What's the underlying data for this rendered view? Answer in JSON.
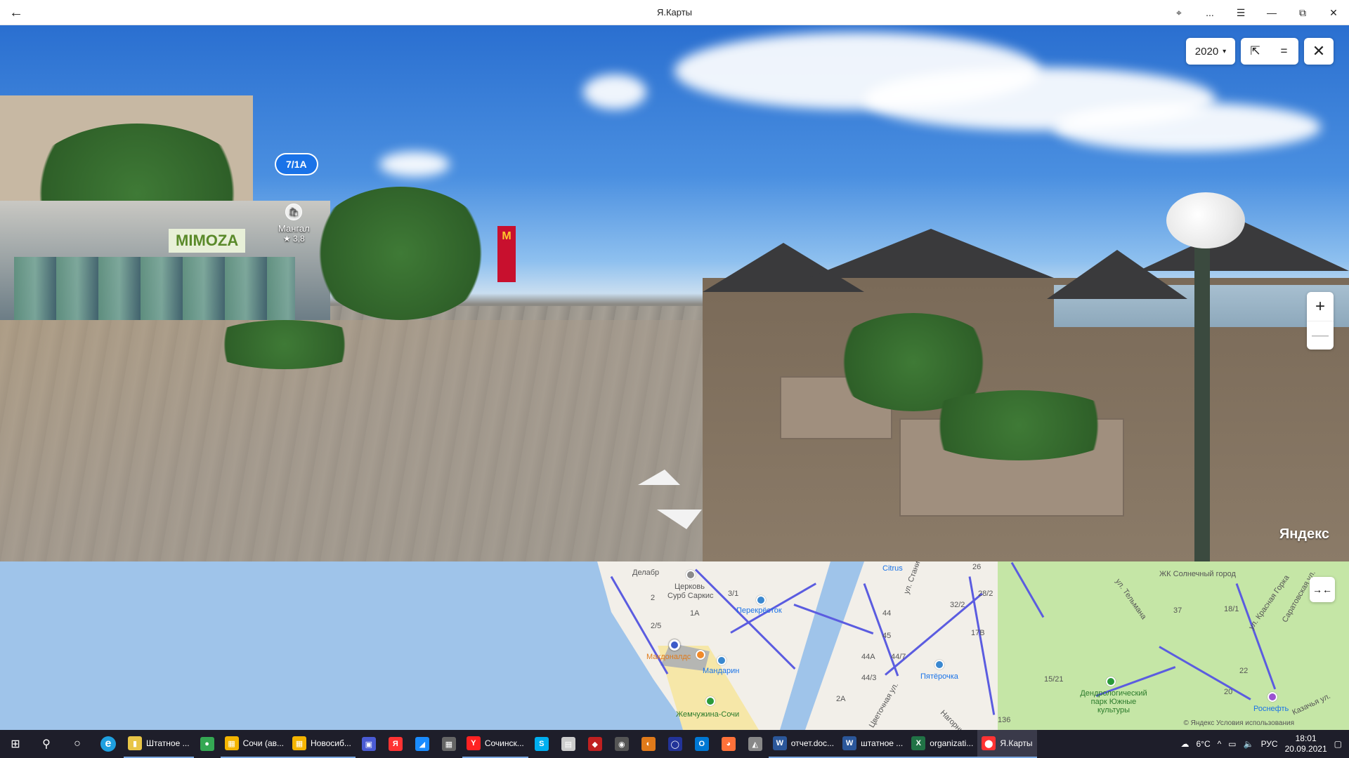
{
  "window": {
    "title": "Я.Карты",
    "back_icon": "arrow-left-icon",
    "controls": [
      "pin-icon",
      "more-icon",
      "menu-icon",
      "minimize-icon",
      "restore-icon",
      "close-icon"
    ],
    "more_label": "...",
    "restore_label": "⧉",
    "close_label": "✕"
  },
  "panorama": {
    "address_label": "7/1A",
    "poi": {
      "name": "Мангал",
      "rating": "★ 3,8"
    },
    "shop_sign": "MIMOZA",
    "banner_letter": "M",
    "brand": "Яндекс",
    "year": "2020",
    "year_caret": "▾",
    "share_icon": "⇱",
    "lines_icon": "=",
    "close_icon": "✕",
    "zoom_in": "+",
    "zoom_out": "—"
  },
  "minimap": {
    "collapse_label": "→←",
    "copyright": "© Яндекс   Условия использования",
    "labels": [
      {
        "text": "Делабр",
        "cls": ""
      },
      {
        "text": "Церковь",
        "cls": ""
      },
      {
        "text": "Сурб Саркис",
        "cls": ""
      },
      {
        "text": "Перекрёсток",
        "cls": "blue"
      },
      {
        "text": "Макдоналдс",
        "cls": "orange"
      },
      {
        "text": "Мандарин",
        "cls": "blue"
      },
      {
        "text": "Жемчужина-Сочи",
        "cls": "green"
      },
      {
        "text": "Citrus",
        "cls": "blue"
      },
      {
        "text": "Пятёрочка",
        "cls": "blue"
      },
      {
        "text": "ул. Станиславского",
        "cls": ""
      },
      {
        "text": "Цветочная ул.",
        "cls": ""
      },
      {
        "text": "Нагорный туп.",
        "cls": ""
      },
      {
        "text": "ЖК Солнечный город",
        "cls": ""
      },
      {
        "text": "ул. Тельмана",
        "cls": ""
      },
      {
        "text": "ул. Красная Горка",
        "cls": ""
      },
      {
        "text": "Саратовская ул.",
        "cls": ""
      },
      {
        "text": "Дендрологический парк Южные культуры",
        "cls": "green"
      },
      {
        "text": "Роснефть",
        "cls": "blue"
      },
      {
        "text": "Казачья ул.",
        "cls": ""
      },
      {
        "text": "26",
        "cls": ""
      },
      {
        "text": "28/2",
        "cls": ""
      },
      {
        "text": "32/2",
        "cls": ""
      },
      {
        "text": "17В",
        "cls": ""
      },
      {
        "text": "44",
        "cls": ""
      },
      {
        "text": "45",
        "cls": ""
      },
      {
        "text": "44А",
        "cls": ""
      },
      {
        "text": "44/7",
        "cls": ""
      },
      {
        "text": "44/3",
        "cls": ""
      },
      {
        "text": "2А",
        "cls": ""
      },
      {
        "text": "15/21",
        "cls": ""
      },
      {
        "text": "136",
        "cls": ""
      },
      {
        "text": "37",
        "cls": ""
      },
      {
        "text": "18/1",
        "cls": ""
      },
      {
        "text": "22",
        "cls": ""
      },
      {
        "text": "20",
        "cls": ""
      },
      {
        "text": "3/1",
        "cls": ""
      },
      {
        "text": "2/5",
        "cls": ""
      },
      {
        "text": "2",
        "cls": ""
      },
      {
        "text": "1А",
        "cls": ""
      }
    ]
  },
  "taskbar": {
    "apps": [
      {
        "label": "Штатное ...",
        "color": "#e8c547",
        "glyph": "▮"
      },
      {
        "label": "",
        "color": "#34a853",
        "glyph": "●"
      },
      {
        "label": "Сочи (ав...",
        "color": "#f4b400",
        "glyph": "▦"
      },
      {
        "label": "Новосиб...",
        "color": "#f4b400",
        "glyph": "▦"
      },
      {
        "label": "",
        "color": "#4a5bd4",
        "glyph": "▣"
      },
      {
        "label": "",
        "color": "#ff3333",
        "glyph": "Я"
      },
      {
        "label": "",
        "color": "#1a8cff",
        "glyph": "◢"
      },
      {
        "label": "",
        "color": "#666",
        "glyph": "▦"
      },
      {
        "label": "Сочинск...",
        "color": "#ff2222",
        "glyph": "Y"
      },
      {
        "label": "",
        "color": "#00aff0",
        "glyph": "S"
      },
      {
        "label": "",
        "color": "#ccc",
        "glyph": "▤"
      },
      {
        "label": "",
        "color": "#c02020",
        "glyph": "◆"
      },
      {
        "label": "",
        "color": "#555",
        "glyph": "◉"
      },
      {
        "label": "",
        "color": "#e07a1a",
        "glyph": "◐"
      },
      {
        "label": "",
        "color": "#223399",
        "glyph": "◯"
      },
      {
        "label": "",
        "color": "#0078d4",
        "glyph": "O"
      },
      {
        "label": "",
        "color": "#ff7139",
        "glyph": "◕"
      },
      {
        "label": "",
        "color": "#888",
        "glyph": "◭"
      },
      {
        "label": "отчет.doc...",
        "color": "#2b579a",
        "glyph": "W"
      },
      {
        "label": "штатное ...",
        "color": "#2b579a",
        "glyph": "W"
      },
      {
        "label": "organizati...",
        "color": "#217346",
        "glyph": "X"
      },
      {
        "label": "Я.Карты",
        "color": "#ff3333",
        "glyph": "⬤"
      }
    ],
    "weather": "6°C",
    "lang": "РУС",
    "time": "18:01",
    "date": "20.09.2021",
    "start_icon": "⊞",
    "search_icon": "⚲",
    "cortana_icon": "○",
    "edge_glyph": "e"
  }
}
